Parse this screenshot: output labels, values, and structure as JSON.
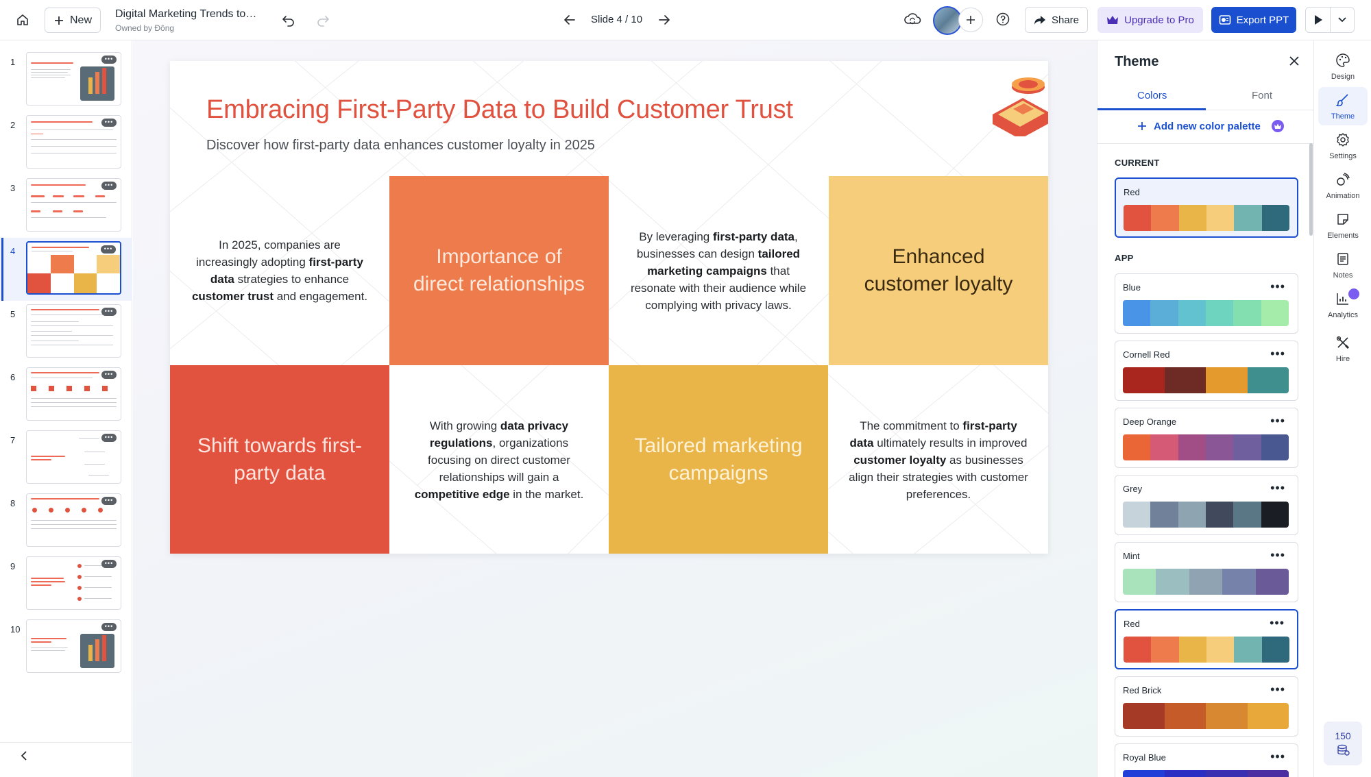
{
  "topbar": {
    "new_label": "New",
    "doc_title": "Digital Marketing Trends to W...",
    "owner": "Owned by Đông",
    "slide_indicator": "Slide 4 / 10",
    "share_label": "Share",
    "upgrade_label": "Upgrade to Pro",
    "export_label": "Export PPT"
  },
  "thumbnails": {
    "numbers": [
      "1",
      "2",
      "3",
      "4",
      "5",
      "6",
      "7",
      "8",
      "9",
      "10"
    ],
    "active": "4"
  },
  "slide": {
    "title": "Embracing First-Party Data to Build Customer Trust",
    "subtitle": "Discover how first-party data enhances customer loyalty in 2025",
    "cells": {
      "c1_a": "In 2025, companies are increasingly adopting ",
      "c1_b": "first-party data",
      "c1_c": " strategies to enhance ",
      "c1_d": "customer trust",
      "c1_e": " and engagement.",
      "c2": "Importance of direct relationships",
      "c3_a": "By leveraging ",
      "c3_b": "first-party data",
      "c3_c": ", businesses can design ",
      "c3_d": "tailored marketing campaigns",
      "c3_e": " that resonate with their audience while complying with privacy laws.",
      "c4": "Enhanced customer loyalty",
      "c5": "Shift towards first-party data",
      "c6_a": "With growing ",
      "c6_b": "data privacy regulations",
      "c6_c": ", organizations focusing on direct customer relationships will gain a ",
      "c6_d": "competitive edge",
      "c6_e": " in the market.",
      "c7": "Tailored marketing campaigns",
      "c8_a": "The commitment to ",
      "c8_b": "first-party data",
      "c8_c": " ultimately results in improved ",
      "c8_d": "customer loyalty",
      "c8_e": " as businesses align their strategies with customer preferences."
    },
    "colors": {
      "title": "#e0523f",
      "orange": "#ee7b4c",
      "light_yellow": "#f6cd7b",
      "red": "#e1533f",
      "gold": "#e9b448"
    }
  },
  "theme_panel": {
    "title": "Theme",
    "tab_colors": "Colors",
    "tab_font": "Font",
    "add_palette": "Add new color palette",
    "current_label": "CURRENT",
    "app_label": "APP",
    "current": {
      "name": "Red",
      "colors": [
        "#e1533f",
        "#ee7b4c",
        "#e9b448",
        "#f6cd7b",
        "#72b5b0",
        "#2e6a7b"
      ]
    },
    "palettes": [
      {
        "name": "Blue",
        "colors": [
          "#4a94e8",
          "#5aaed8",
          "#62c2cf",
          "#6ed3bf",
          "#84dfb0",
          "#a5ecaa"
        ]
      },
      {
        "name": "Cornell Red",
        "colors": [
          "#a8261d",
          "#6e2a24",
          "#e59a2e",
          "#3f8f8e"
        ]
      },
      {
        "name": "Deep Orange",
        "colors": [
          "#ea6637",
          "#d45a75",
          "#a24e86",
          "#8a5696",
          "#6f5f9e",
          "#4a5891"
        ]
      },
      {
        "name": "Grey",
        "colors": [
          "#c7d3db",
          "#71819a",
          "#8fa4b1",
          "#404a5c",
          "#5a7785",
          "#1a1e24"
        ]
      },
      {
        "name": "Mint",
        "colors": [
          "#a9e3bc",
          "#9bbfc0",
          "#8fa3b3",
          "#7782ab",
          "#6b5a98"
        ]
      },
      {
        "name": "Red",
        "colors": [
          "#e1533f",
          "#ee7b4c",
          "#e9b448",
          "#f6cd7b",
          "#72b5b0",
          "#2e6a7b"
        ]
      },
      {
        "name": "Red Brick",
        "colors": [
          "#a53a27",
          "#c55b28",
          "#d88830",
          "#e8a93a"
        ]
      },
      {
        "name": "Royal Blue",
        "colors": [
          "#1f3fd8",
          "#2b2ec2",
          "#3a2fb0",
          "#4c2ea3"
        ]
      }
    ]
  },
  "rail": {
    "items": [
      "Design",
      "Theme",
      "Settings",
      "Animation",
      "Elements",
      "Notes",
      "Analytics",
      "Hire"
    ],
    "credits": "150"
  }
}
